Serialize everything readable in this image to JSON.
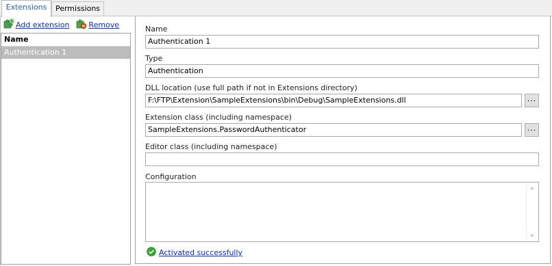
{
  "tabs": [
    {
      "label": "Extensions",
      "active": true
    },
    {
      "label": "Permissions",
      "active": false
    }
  ],
  "toolbar": {
    "add_label": "Add extension",
    "remove_label": "Remove"
  },
  "list": {
    "header": "Name",
    "items": [
      "Authentication 1"
    ]
  },
  "form": {
    "name_label": "Name",
    "name_value": "Authentication 1",
    "type_label": "Type",
    "type_value": "Authentication",
    "dll_label": "DLL location (use full path if not in Extensions directory)",
    "dll_value": "F:\\FTP\\Extension\\SampleExtensions\\bin\\Debug\\SampleExtensions.dll",
    "class_label": "Extension class (including namespace)",
    "class_value": "SampleExtensions.PasswordAuthenticator",
    "editor_label": "Editor class (including namespace)",
    "editor_value": "",
    "config_label": "Configuration",
    "config_value": "",
    "browse_label": "..."
  },
  "status": {
    "text": "Activated successfully"
  },
  "colors": {
    "active_tab_text": "#1a64c4",
    "link": "#0a2bd8",
    "selected_row": "#bcbcbc",
    "success_icon": "#3aa935"
  }
}
